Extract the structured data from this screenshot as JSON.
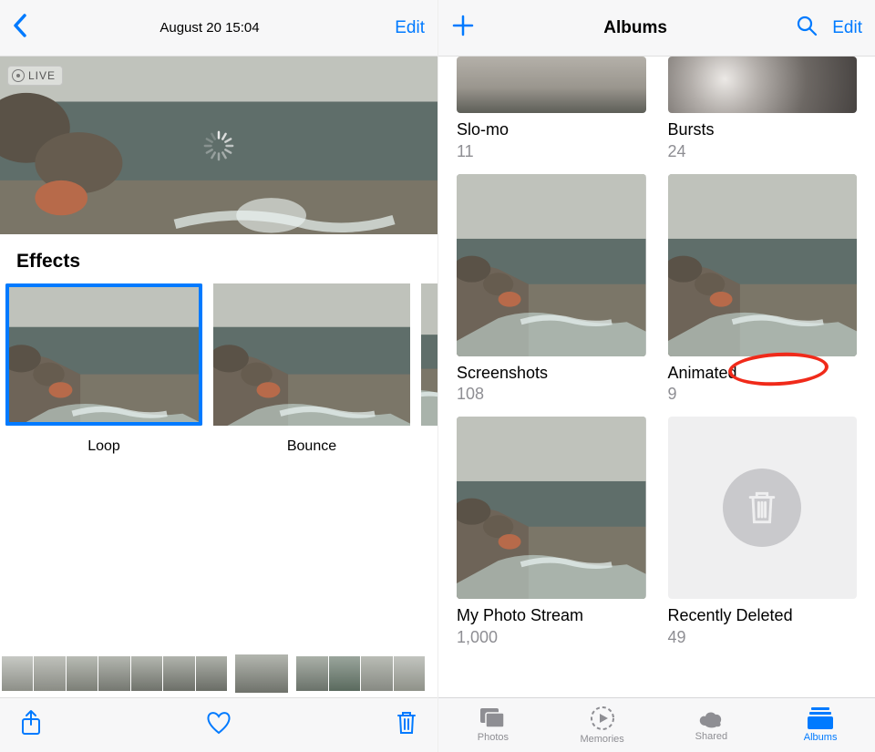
{
  "left": {
    "timestamp": "August 20  15:04",
    "edit": "Edit",
    "live_badge": "LIVE",
    "effects_title": "Effects",
    "effects": [
      {
        "label": "Loop",
        "selected": true
      },
      {
        "label": "Bounce",
        "selected": false
      }
    ]
  },
  "right": {
    "title": "Albums",
    "edit": "Edit",
    "albums": [
      {
        "name": "Slo-mo",
        "count": "11",
        "thumb": "gray-horizon"
      },
      {
        "name": "Bursts",
        "count": "24",
        "thumb": "bokeh"
      },
      {
        "name": "Screenshots",
        "count": "108",
        "thumb": "beach"
      },
      {
        "name": "Animated",
        "count": "9",
        "thumb": "beach",
        "circled": true
      },
      {
        "name": "My Photo Stream",
        "count": "1,000",
        "thumb": "beach"
      },
      {
        "name": "Recently Deleted",
        "count": "49",
        "thumb": "trash"
      }
    ],
    "tabs": [
      {
        "label": "Photos",
        "icon": "photos",
        "active": false
      },
      {
        "label": "Memories",
        "icon": "memories",
        "active": false
      },
      {
        "label": "Shared",
        "icon": "shared",
        "active": false
      },
      {
        "label": "Albums",
        "icon": "albums",
        "active": true
      }
    ]
  }
}
